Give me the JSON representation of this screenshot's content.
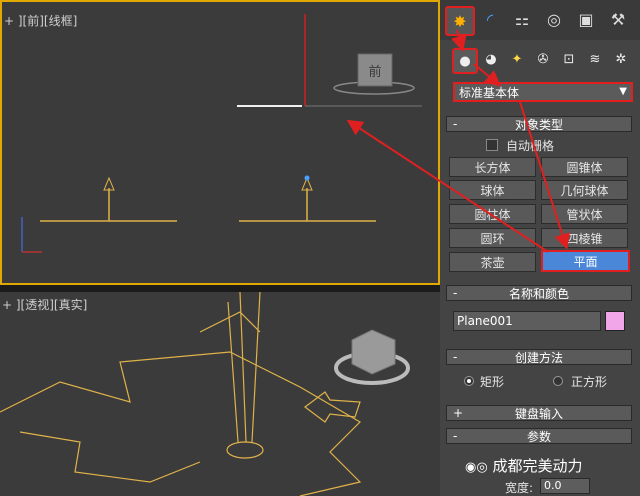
{
  "viewport_front": {
    "label": "+ ][前][线框]",
    "viewcube_label": "前"
  },
  "viewport_persp": {
    "label": "+ ][透视][真实]"
  },
  "command_panel": {
    "tabs": [
      {
        "icon": "create-icon",
        "glyph": "✸"
      },
      {
        "icon": "modify-icon",
        "glyph": "◜"
      },
      {
        "icon": "hierarchy-icon",
        "glyph": "⚏"
      },
      {
        "icon": "motion-icon",
        "glyph": "◎"
      },
      {
        "icon": "display-icon",
        "glyph": "▣"
      },
      {
        "icon": "utilities-icon",
        "glyph": "⚒"
      }
    ],
    "subtabs": [
      {
        "icon": "geometry-icon",
        "glyph": "●"
      },
      {
        "icon": "shapes-icon",
        "glyph": "◕"
      },
      {
        "icon": "lights-icon",
        "glyph": "✦"
      },
      {
        "icon": "cameras-icon",
        "glyph": "✇"
      },
      {
        "icon": "helpers-icon",
        "glyph": "⊡"
      },
      {
        "icon": "spacewarps-icon",
        "glyph": "≋"
      },
      {
        "icon": "systems-icon",
        "glyph": "✲"
      }
    ],
    "dropdown": {
      "value": "标准基本体"
    },
    "object_type": {
      "title": "对象类型",
      "sign": "-",
      "autogrid": "自动栅格",
      "buttons": [
        "长方体",
        "圆锥体",
        "球体",
        "几何球体",
        "圆柱体",
        "管状体",
        "圆环",
        "四棱锥",
        "茶壶",
        "平面"
      ],
      "selected": "平面"
    },
    "name_color": {
      "title": "名称和颜色",
      "sign": "-",
      "name": "Plane001",
      "color": "#f0a6e8"
    },
    "creation_method": {
      "title": "创建方法",
      "sign": "-",
      "options": [
        "矩形",
        "正方形"
      ],
      "selected": "矩形"
    },
    "keyboard_entry": {
      "title": "键盘输入",
      "sign": "+"
    },
    "parameters": {
      "title": "参数",
      "sign": "-",
      "width_label": "宽度:",
      "width_value": "0.0"
    }
  },
  "watermark": "成都完美动力",
  "colors": {
    "highlight": "#e02020",
    "selected_button": "#4a87d8",
    "active_viewport_border": "#e0a800"
  }
}
